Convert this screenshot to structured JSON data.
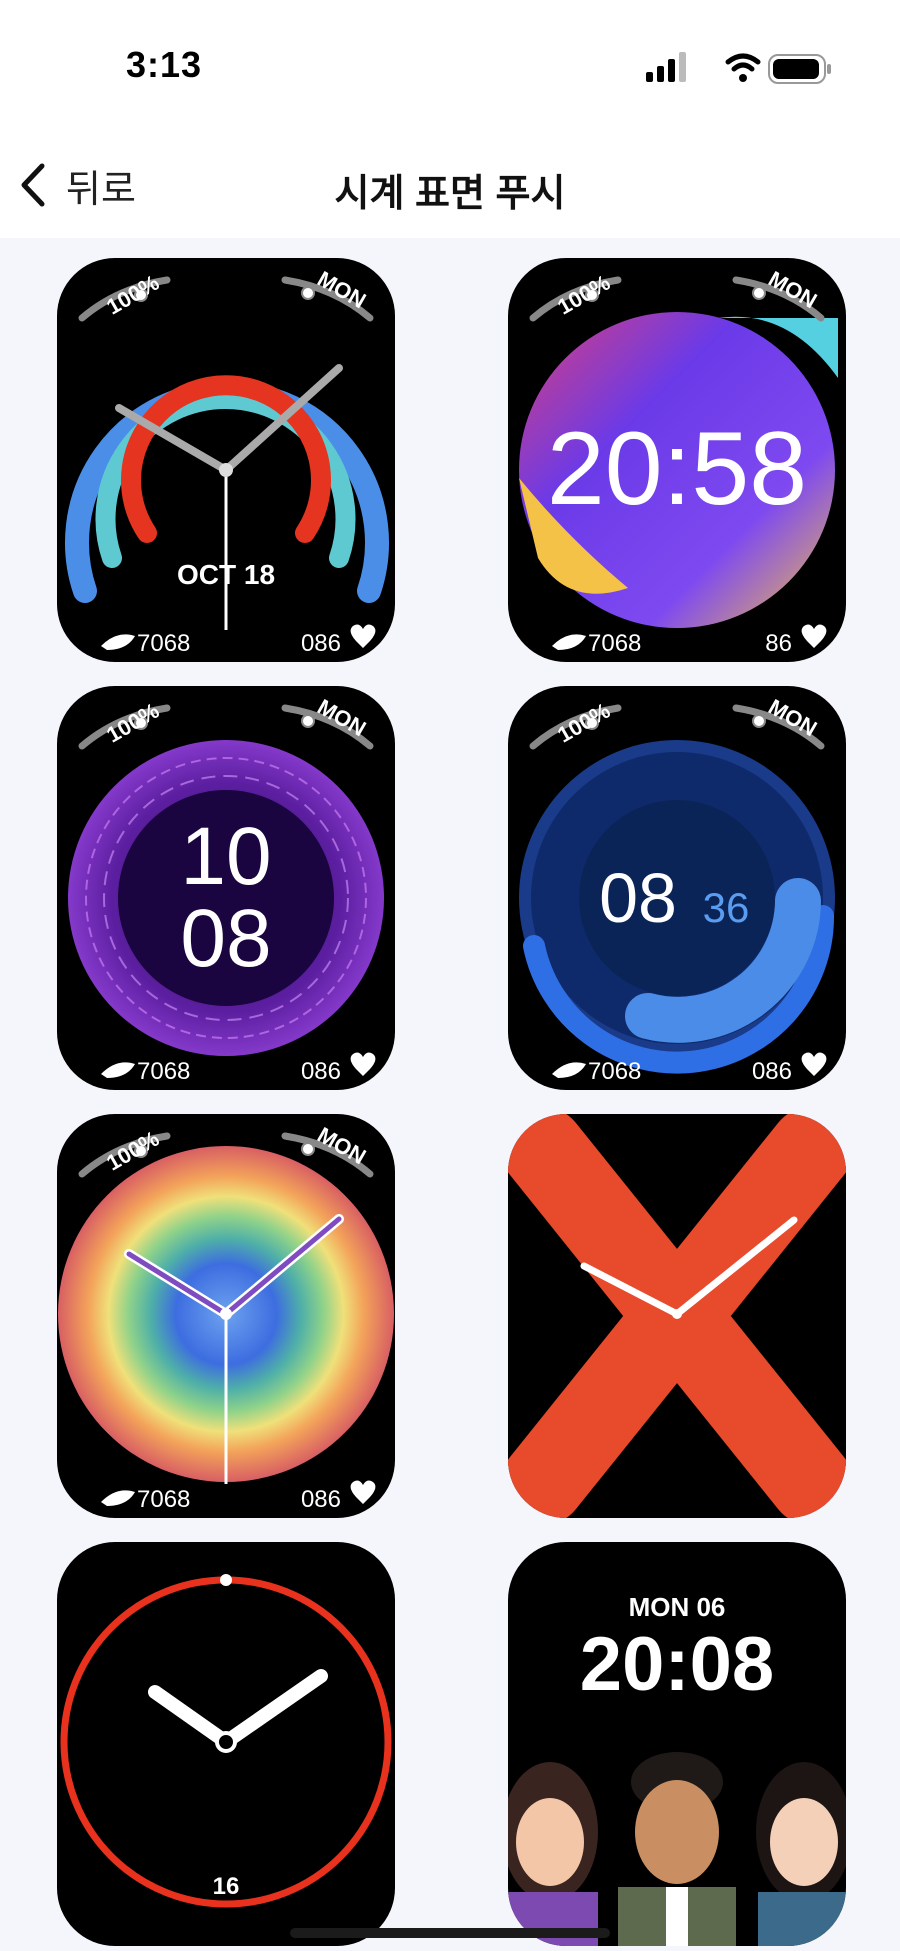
{
  "status": {
    "time": "3:13"
  },
  "nav": {
    "back_label": "뒤로",
    "title": "시계 표면 푸시"
  },
  "faces": [
    {
      "battery": "100%",
      "day": "MON",
      "date": "OCT 18",
      "steps": "7068",
      "heart": "086"
    },
    {
      "battery": "100%",
      "day": "MON",
      "clock": "20:58",
      "steps": "7068",
      "heart": "86"
    },
    {
      "battery": "100%",
      "day": "MON",
      "hour": "10",
      "minute": "08",
      "steps": "7068",
      "heart": "086"
    },
    {
      "battery": "100%",
      "day": "MON",
      "hour": "08",
      "minute": "36",
      "steps": "7068",
      "heart": "086"
    },
    {
      "battery": "100%",
      "day": "MON",
      "steps": "7068",
      "heart": "086"
    },
    {},
    {
      "number": "16"
    },
    {
      "date": "MON 06",
      "clock": "20:08"
    }
  ],
  "colors": {
    "accent_red": "#e8321e",
    "face_bg": "#000000",
    "page_bg": "#f4f6fb"
  }
}
